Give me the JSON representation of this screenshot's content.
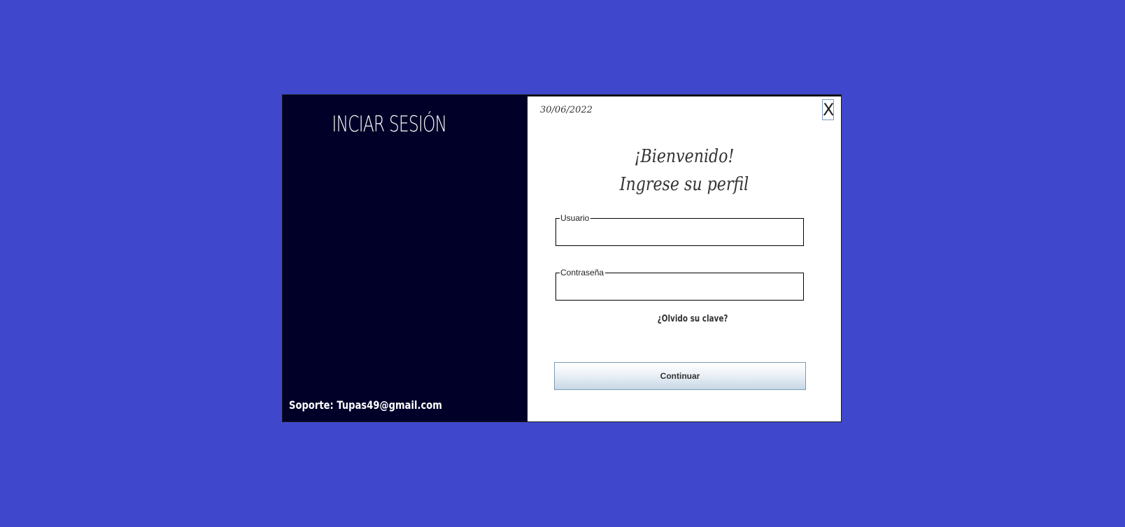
{
  "left": {
    "title": "INCIAR SESIÓN",
    "support": "Soporte: Tupas49@gmail.com"
  },
  "right": {
    "date": "30/06/2022",
    "close_label": "X",
    "welcome_line1": "¡Bienvenido!",
    "welcome_line2": "Ingrese su perfil",
    "username": {
      "label": "Usuario",
      "value": ""
    },
    "password": {
      "label": "Contraseña",
      "value": ""
    },
    "forgot_label": "¿Olvido su clave?",
    "continue_label": "Continuar"
  },
  "colors": {
    "background": "#3f48cc",
    "left_panel": "#000028",
    "right_panel": "#ffffff"
  }
}
